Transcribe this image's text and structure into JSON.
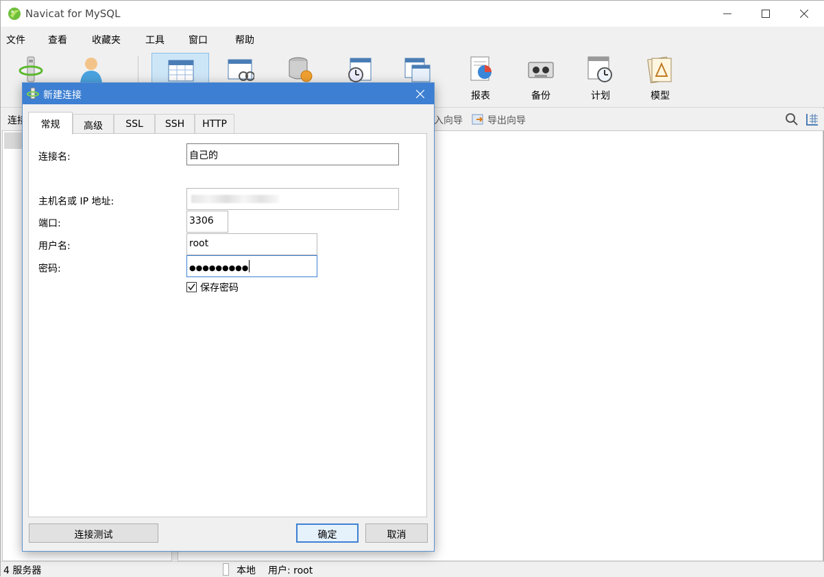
{
  "window": {
    "title": "Navicat for MySQL"
  },
  "menu": {
    "items": [
      "文件",
      "查看",
      "收藏夹",
      "工具",
      "窗口",
      "帮助"
    ]
  },
  "toolbar": {
    "items": [
      {
        "label": "",
        "icon": "connection-icon"
      },
      {
        "label": "",
        "icon": "user-icon"
      },
      {
        "label": "",
        "icon": "table-icon",
        "active": true
      },
      {
        "label": "",
        "icon": "view-icon"
      },
      {
        "label": "",
        "icon": "function-icon"
      },
      {
        "label": "",
        "icon": "event-icon"
      },
      {
        "label": "",
        "icon": "query-icon"
      },
      {
        "label": "报表",
        "icon": "report-icon"
      },
      {
        "label": "备份",
        "icon": "backup-icon"
      },
      {
        "label": "计划",
        "icon": "schedule-icon"
      },
      {
        "label": "模型",
        "icon": "model-icon"
      }
    ]
  },
  "subbar": {
    "left_label": "连接",
    "import_wizard": "入向导",
    "export_wizard": "导出向导"
  },
  "statusbar": {
    "server_count": "4 服务器",
    "location": "本地",
    "user": "用户: root"
  },
  "dialog": {
    "title": "新建连接",
    "tabs": [
      "常规",
      "高级",
      "SSL",
      "SSH",
      "HTTP"
    ],
    "active_tab": "常规",
    "fields": {
      "connection_name_label": "连接名:",
      "connection_name_value": "自己的",
      "host_label": "主机名或 IP 地址:",
      "host_value": "",
      "port_label": "端口:",
      "port_value": "3306",
      "username_label": "用户名:",
      "username_value": "root",
      "password_label": "密码:",
      "password_value": "●●●●●●●●●"
    },
    "save_password": {
      "label": "保存密码",
      "checked": true
    },
    "buttons": {
      "test": "连接测试",
      "ok": "确定",
      "cancel": "取消"
    }
  },
  "colors": {
    "dialog_title_bg": "#3d7fd2",
    "active_tool_bg": "#cde6f7",
    "focus_border": "#3d7fd2"
  }
}
